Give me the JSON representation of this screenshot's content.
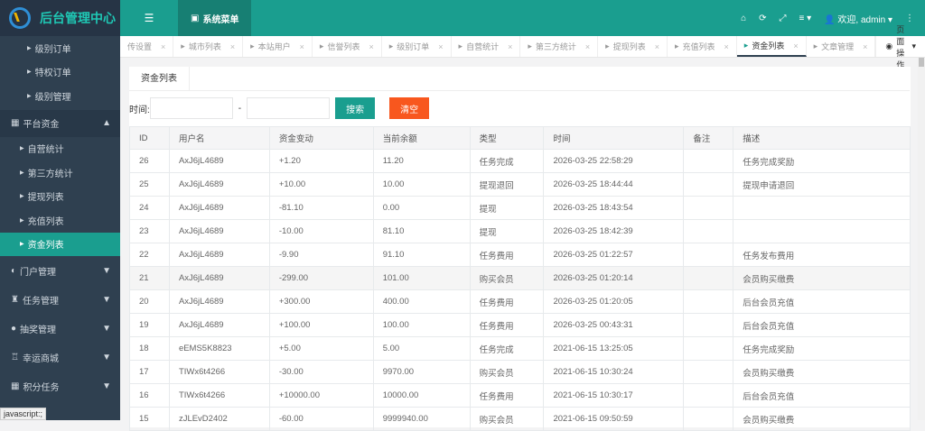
{
  "app": {
    "title": "后台管理中心"
  },
  "topbar": {
    "menu_label": "系统菜单",
    "welcome": "欢迎, admin"
  },
  "sidebar": {
    "top_items": [
      "级别订单",
      "特权订单",
      "级别管理"
    ],
    "section": {
      "label": "平台资金",
      "items": [
        "自营统计",
        "第三方统计",
        "提现列表",
        "充值列表",
        "资金列表"
      ]
    },
    "sections": [
      "门户管理",
      "任务管理",
      "抽奖管理",
      "幸运商城",
      "积分任务"
    ]
  },
  "tabs": [
    {
      "label": "传设置"
    },
    {
      "label": "城市列表"
    },
    {
      "label": "本站用户"
    },
    {
      "label": "信誉列表"
    },
    {
      "label": "级别订单"
    },
    {
      "label": "自营统计"
    },
    {
      "label": "第三方统计"
    },
    {
      "label": "提现列表"
    },
    {
      "label": "充值列表"
    },
    {
      "label": "资金列表"
    },
    {
      "label": "文章管理"
    }
  ],
  "page_ops": "页面操作",
  "content": {
    "tab": "资金列表",
    "time_label": "时间:",
    "dash": "-",
    "search_btn": "搜索",
    "clear_btn": "清空"
  },
  "table": {
    "headers": [
      "ID",
      "用户名",
      "资金变动",
      "当前余额",
      "类型",
      "时间",
      "备注",
      "描述"
    ],
    "rows": [
      [
        "26",
        "AxJ6jL4689",
        "+1.20",
        "11.20",
        "任务完成",
        "2026-03-25 22:58:29",
        "",
        "任务完成奖励"
      ],
      [
        "25",
        "AxJ6jL4689",
        "+10.00",
        "10.00",
        "提现退回",
        "2026-03-25 18:44:44",
        "",
        "提现申请退回"
      ],
      [
        "24",
        "AxJ6jL4689",
        "-81.10",
        "0.00",
        "提现",
        "2026-03-25 18:43:54",
        "",
        ""
      ],
      [
        "23",
        "AxJ6jL4689",
        "-10.00",
        "81.10",
        "提现",
        "2026-03-25 18:42:39",
        "",
        ""
      ],
      [
        "22",
        "AxJ6jL4689",
        "-9.90",
        "91.10",
        "任务费用",
        "2026-03-25 01:22:57",
        "",
        "任务发布费用"
      ],
      [
        "21",
        "AxJ6jL4689",
        "-299.00",
        "101.00",
        "购买会员",
        "2026-03-25 01:20:14",
        "",
        "会员购买缴费"
      ],
      [
        "20",
        "AxJ6jL4689",
        "+300.00",
        "400.00",
        "任务费用",
        "2026-03-25 01:20:05",
        "",
        "后台会员充值"
      ],
      [
        "19",
        "AxJ6jL4689",
        "+100.00",
        "100.00",
        "任务费用",
        "2026-03-25 00:43:31",
        "",
        "后台会员充值"
      ],
      [
        "18",
        "eEMS5K8823",
        "+5.00",
        "5.00",
        "任务完成",
        "2021-06-15 13:25:05",
        "",
        "任务完成奖励"
      ],
      [
        "17",
        "TIWx6t4266",
        "-30.00",
        "9970.00",
        "购买会员",
        "2021-06-15 10:30:24",
        "",
        "会员购买缴费"
      ],
      [
        "16",
        "TIWx6t4266",
        "+10000.00",
        "10000.00",
        "任务费用",
        "2021-06-15 10:30:17",
        "",
        "后台会员充值"
      ],
      [
        "15",
        "zJLEvD2402",
        "-60.00",
        "9999940.00",
        "购买会员",
        "2021-06-15 09:50:59",
        "",
        "会员购买缴费"
      ]
    ]
  },
  "statusbar": "javascript:;",
  "colors": {
    "teal": "#1a9e8f",
    "sidebar": "#2f4050",
    "search": "#1a9e8f",
    "clear": "#f8571e"
  }
}
